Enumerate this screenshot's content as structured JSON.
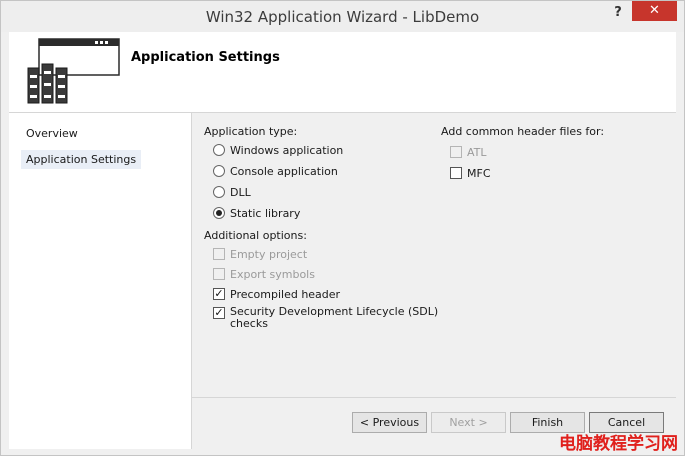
{
  "window": {
    "title": "Win32 Application Wizard - LibDemo",
    "help_label": "?",
    "close_label": "✕"
  },
  "header": {
    "title": "Application Settings"
  },
  "nav": {
    "items": [
      {
        "label": "Overview"
      },
      {
        "label": "Application Settings"
      }
    ]
  },
  "app_type": {
    "label": "Application type:",
    "options": [
      {
        "label": "Windows application",
        "checked": false
      },
      {
        "label": "Console application",
        "checked": false
      },
      {
        "label": "DLL",
        "checked": false
      },
      {
        "label": "Static library",
        "checked": true
      }
    ]
  },
  "additional": {
    "label": "Additional options:",
    "options": [
      {
        "label": "Empty project",
        "checked": false,
        "disabled": true
      },
      {
        "label": "Export symbols",
        "checked": false,
        "disabled": true
      },
      {
        "label": "Precompiled header",
        "checked": true,
        "disabled": false
      },
      {
        "label": "Security Development Lifecycle (SDL)",
        "label2": "checks",
        "checked": true,
        "disabled": false
      }
    ]
  },
  "headers": {
    "label": "Add common header files for:",
    "options": [
      {
        "label": "ATL",
        "checked": false,
        "disabled": true
      },
      {
        "label": "MFC",
        "checked": false,
        "disabled": false
      }
    ]
  },
  "buttons": {
    "previous": "< Previous",
    "next": "Next >",
    "finish": "Finish",
    "cancel": "Cancel"
  },
  "watermark": "电脑教程学习网",
  "colors": {
    "close_button": "#c7352c",
    "watermark": "#e0201c"
  }
}
